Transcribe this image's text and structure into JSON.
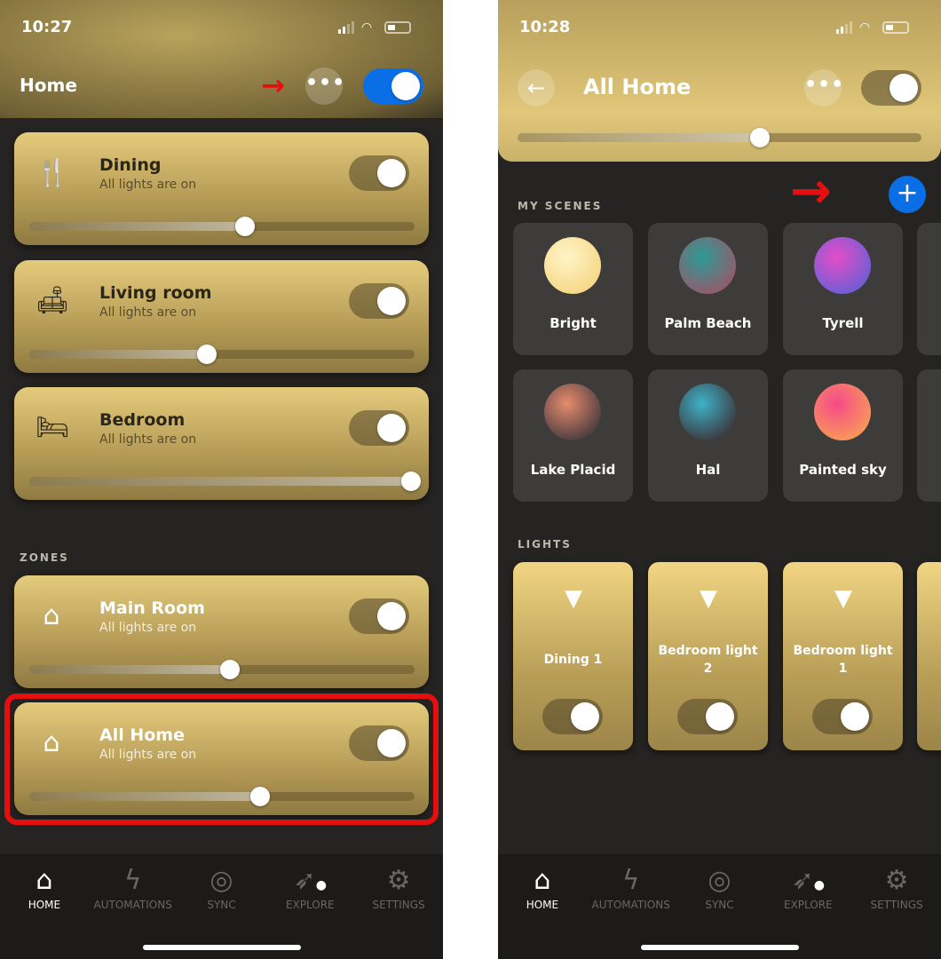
{
  "left": {
    "status": {
      "time": "10:27"
    },
    "header": {
      "title": "Home",
      "more_label": "•••",
      "master_on": true
    },
    "rooms": [
      {
        "name": "Dining",
        "status": "All lights are on",
        "icon": "fork-knife-icon",
        "on": true,
        "brightness": 56
      },
      {
        "name": "Living room",
        "status": "All lights are on",
        "icon": "sofa-icon",
        "on": true,
        "brightness": 46
      },
      {
        "name": "Bedroom",
        "status": "All lights are on",
        "icon": "bed-icon",
        "on": true,
        "brightness": 99
      }
    ],
    "zones_label": "ZONES",
    "zones": [
      {
        "name": "Main Room",
        "status": "All lights are on",
        "icon": "house-icon",
        "on": true,
        "brightness": 52
      },
      {
        "name": "All Home",
        "status": "All lights are on",
        "icon": "house-icon",
        "on": true,
        "brightness": 60
      }
    ]
  },
  "right": {
    "status": {
      "time": "10:28"
    },
    "header": {
      "title": "All Home",
      "more_label": "•••",
      "on": true,
      "brightness": 60
    },
    "scenes_label": "MY SCENES",
    "scenes": [
      {
        "name": "Bright",
        "colors": [
          "#fff4c8",
          "#f3cf72"
        ]
      },
      {
        "name": "Palm Beach",
        "colors": [
          "#2c9b97",
          "#b3475f"
        ]
      },
      {
        "name": "Tyrell",
        "colors": [
          "#e44ec8",
          "#4a62d8"
        ]
      },
      {
        "name": "Lake Placid",
        "colors": [
          "#e68c6c",
          "#1e2434"
        ]
      },
      {
        "name": "Hal",
        "colors": [
          "#3fb2c8",
          "#3a1618"
        ]
      },
      {
        "name": "Painted sky",
        "colors": [
          "#f64a8a",
          "#f8b04a"
        ]
      }
    ],
    "lights_label": "LIGHTS",
    "lights": [
      {
        "name": "Dining 1",
        "on": true
      },
      {
        "name": "Bedroom light 2",
        "on": true
      },
      {
        "name": "Bedroom light 1",
        "on": true
      }
    ]
  },
  "nav": [
    {
      "label": "HOME",
      "icon": "home-icon",
      "active": true
    },
    {
      "label": "AUTOMATIONS",
      "icon": "lightning-icon"
    },
    {
      "label": "SYNC",
      "icon": "sync-icon"
    },
    {
      "label": "EXPLORE",
      "icon": "rocket-icon"
    },
    {
      "label": "SETTINGS",
      "icon": "gear-icon"
    }
  ],
  "colors": {
    "accent": "#0a6fe6",
    "annotation": "#e60f0f",
    "background": "#252422"
  }
}
